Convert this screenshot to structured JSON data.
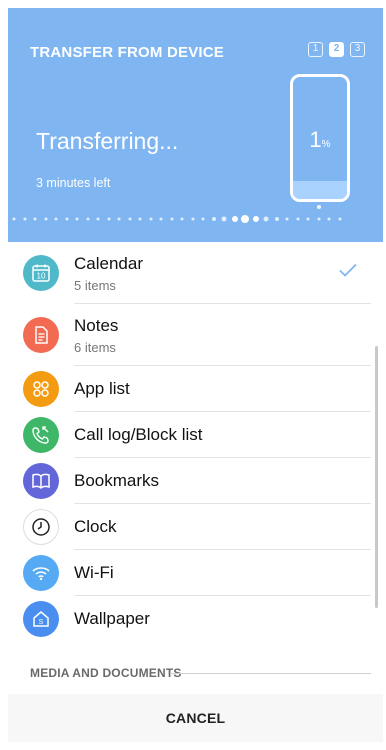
{
  "header": {
    "title": "TRANSFER FROM DEVICE",
    "steps": [
      "1",
      "2",
      "3"
    ],
    "active_step": 2,
    "status": "Transferring...",
    "time_left": "3 minutes left",
    "progress_value": "1",
    "progress_unit": "%"
  },
  "colors": {
    "header_bg": "#7fb6f2",
    "check": "#7fb6f2",
    "calendar": "#4fb9c9",
    "notes": "#f26a52",
    "app_list": "#f39c12",
    "call_log": "#3fb769",
    "bookmarks": "#6266d8",
    "clock": "#ffffff",
    "wifi": "#56aaf4",
    "wallpaper": "#4a8ef0"
  },
  "items": [
    {
      "label": "Calendar",
      "sub": "5 items",
      "icon": "calendar-icon",
      "checked": true
    },
    {
      "label": "Notes",
      "sub": "6 items",
      "icon": "notes-icon"
    },
    {
      "label": "App list",
      "icon": "app-list-icon"
    },
    {
      "label": "Call log/Block list",
      "icon": "call-log-icon"
    },
    {
      "label": "Bookmarks",
      "icon": "bookmarks-icon"
    },
    {
      "label": "Clock",
      "icon": "clock-icon"
    },
    {
      "label": "Wi-Fi",
      "icon": "wifi-icon"
    },
    {
      "label": "Wallpaper",
      "icon": "wallpaper-icon"
    }
  ],
  "calendar_icon_day": "10",
  "section_label": "MEDIA AND DOCUMENTS",
  "footer": {
    "cancel": "CANCEL"
  }
}
